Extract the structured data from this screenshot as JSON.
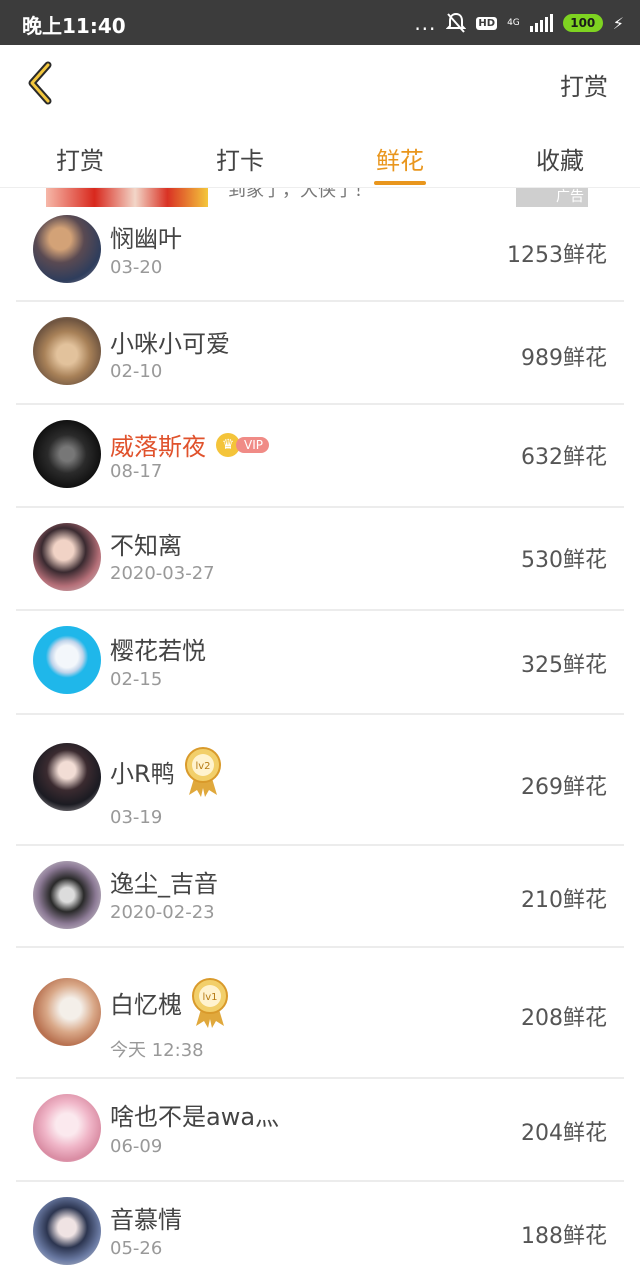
{
  "status_bar": {
    "time": "晚上11:40",
    "dots": "...",
    "hd": "HD",
    "network": "4G",
    "battery": "100"
  },
  "nav": {
    "action": "打赏"
  },
  "tabs": [
    {
      "label": "打赏"
    },
    {
      "label": "打卡"
    },
    {
      "label": "鲜花"
    },
    {
      "label": "收藏"
    }
  ],
  "ad": {
    "text": "到家了，大侠了！",
    "tag": "广告"
  },
  "list": [
    {
      "name": "悯幽叶",
      "date": "03-20",
      "amount": "1253鲜花"
    },
    {
      "name": "小咪小可爱",
      "date": "02-10",
      "amount": "989鲜花"
    },
    {
      "name": "威落斯夜",
      "date": "08-17",
      "amount": "632鲜花",
      "vip": "VIP"
    },
    {
      "name": "不知离",
      "date": "2020-03-27",
      "amount": "530鲜花"
    },
    {
      "name": "樱花若悦",
      "date": "02-15",
      "amount": "325鲜花"
    },
    {
      "name": "小R鸭",
      "date": "03-19",
      "amount": "269鲜花",
      "level": "lv2"
    },
    {
      "name": "逸尘_吉音",
      "date": "2020-02-23",
      "amount": "210鲜花"
    },
    {
      "name": "白忆槐",
      "date": "今天 12:38",
      "amount": "208鲜花",
      "level": "lv1"
    },
    {
      "name": "啥也不是awa灬",
      "date": "06-09",
      "amount": "204鲜花"
    },
    {
      "name": "音慕情",
      "date": "05-26",
      "amount": "188鲜花"
    }
  ],
  "colors": {
    "accent": "#e9961d",
    "vip_name": "#e0522c",
    "status_bar": "#3c3c3c"
  }
}
